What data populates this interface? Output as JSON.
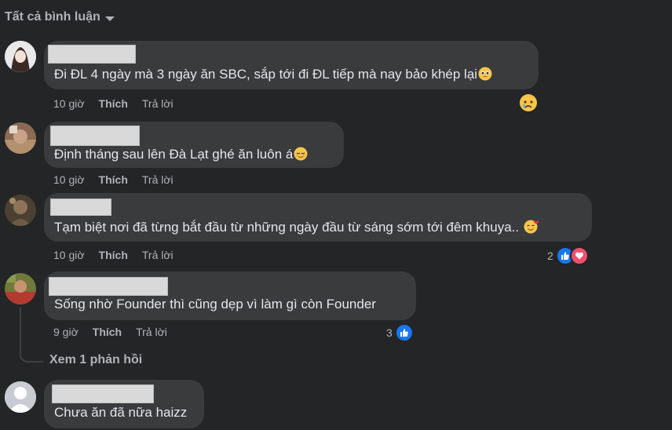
{
  "filter": {
    "label": "Tất cả bình luận",
    "icon": "caret-down-icon"
  },
  "comments": [
    {
      "text": "Đi ĐL 4 ngày mà 3 ngày ăn SBC, sắp tới đi ĐL tiếp mà nay bảo khép lại",
      "emoji": "pleading-face-icon",
      "time": "10 giờ",
      "like_label": "Thích",
      "reply_label": "Trả lời",
      "reaction": "sad-face-icon"
    },
    {
      "text": "Định tháng sau lên Đà Lạt ghé ăn luôn á",
      "emoji": "relieved-face-icon",
      "time": "10 giờ",
      "like_label": "Thích",
      "reply_label": "Trả lời"
    },
    {
      "text": "Tạm biệt nơi đã từng bắt đầu từ những ngày đầu từ sáng sớm tới đêm khuya..",
      "emoji": "smiling-face-with-hearts-icon",
      "time": "10 giờ",
      "like_label": "Thích",
      "reply_label": "Trả lời",
      "reaction_count": "2",
      "reactions": [
        "like-icon",
        "love-icon"
      ]
    },
    {
      "text": "Sống nhờ Founder thì cũng dẹp vì làm gì còn Founder",
      "time": "9 giờ",
      "like_label": "Thích",
      "reply_label": "Trả lời",
      "reaction_count": "3",
      "reactions": [
        "like-icon"
      ],
      "view_replies": "Xem 1 phản hồi"
    },
    {
      "text": "Chưa ăn đã nữa haizz"
    }
  ],
  "colors": {
    "background": "#242526",
    "bubble": "#3a3b3c",
    "text": "#e4e6eb",
    "secondary": "#b0b3b8",
    "like_blue": "#1877f2",
    "love_red": "#f0506e"
  }
}
